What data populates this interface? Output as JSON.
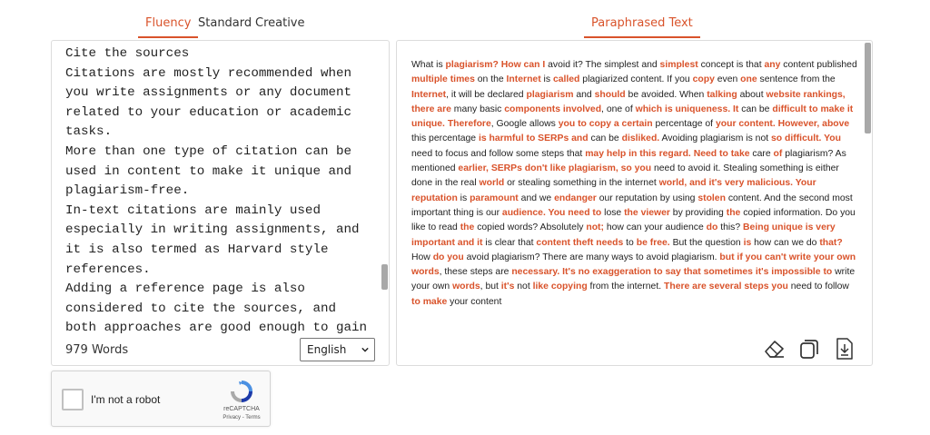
{
  "modes": {
    "fluency": "Fluency",
    "standard": "Standard",
    "creative": "Creative"
  },
  "output_tab": "Paraphrased Text",
  "input": {
    "text": "Cite the sources\nCitations are mostly recommended when you write assignments or any document related to your education or academic tasks.\nMore than one type of citation can be used in content to make it unique and plagiarism-free.\nIn-text citations are mainly used especially in writing assignments, and it is also termed as Harvard style references.\nAdding a reference page is also considered to cite the sources, and both approaches are good enough to gain trust and free yourself from plagiarism.",
    "word_count": "979 Words",
    "language": "English"
  },
  "output": {
    "segments": [
      {
        "t": "What is "
      },
      {
        "t": "plagiarism? How can I",
        "h": true
      },
      {
        "t": " avoid it? The simplest and "
      },
      {
        "t": "simplest",
        "h": true
      },
      {
        "t": " concept is that "
      },
      {
        "t": "any",
        "h": true
      },
      {
        "t": " content published "
      },
      {
        "t": "multiple times",
        "h": true
      },
      {
        "t": " on the "
      },
      {
        "t": "Internet",
        "h": true
      },
      {
        "t": " is "
      },
      {
        "t": "called",
        "h": true
      },
      {
        "t": " plagiarized content. If you "
      },
      {
        "t": "copy",
        "h": true
      },
      {
        "t": " even "
      },
      {
        "t": "one",
        "h": true
      },
      {
        "t": " sentence from the "
      },
      {
        "t": "Internet",
        "h": true
      },
      {
        "t": ", it will be declared "
      },
      {
        "t": "plagiarism",
        "h": true
      },
      {
        "t": " and "
      },
      {
        "t": "should",
        "h": true
      },
      {
        "t": " be avoided. When "
      },
      {
        "t": "talking",
        "h": true
      },
      {
        "t": " about "
      },
      {
        "t": "website rankings, there are",
        "h": true
      },
      {
        "t": " many basic "
      },
      {
        "t": "components involved",
        "h": true
      },
      {
        "t": ", one of "
      },
      {
        "t": "which is uniqueness. It",
        "h": true
      },
      {
        "t": " can be "
      },
      {
        "t": "difficult to make it unique. Therefore",
        "h": true
      },
      {
        "t": ", Google allows "
      },
      {
        "t": "you to copy a certain",
        "h": true
      },
      {
        "t": " percentage of "
      },
      {
        "t": "your content. However, above",
        "h": true
      },
      {
        "t": " this percentage "
      },
      {
        "t": "is harmful to SERPs and",
        "h": true
      },
      {
        "t": " can be "
      },
      {
        "t": "disliked.",
        "h": true
      },
      {
        "t": " Avoiding plagiarism is not "
      },
      {
        "t": "so difficult. You",
        "h": true
      },
      {
        "t": " need to focus and follow some steps that "
      },
      {
        "t": "may help in this regard. Need to take",
        "h": true
      },
      {
        "t": " care "
      },
      {
        "t": "of",
        "h": true
      },
      {
        "t": " plagiarism? As  mentioned "
      },
      {
        "t": "earlier, SERPs don't like plagiarism, so you",
        "h": true
      },
      {
        "t": " need to avoid it. Stealing something is  either  done in the real "
      },
      {
        "t": "world",
        "h": true
      },
      {
        "t": " or  stealing something in the internet "
      },
      {
        "t": "world, and it's very malicious. Your reputation",
        "h": true
      },
      {
        "t": " is "
      },
      {
        "t": "paramount",
        "h": true
      },
      {
        "t": " and we "
      },
      {
        "t": "endanger",
        "h": true
      },
      {
        "t": " our reputation  by using "
      },
      {
        "t": "stolen",
        "h": true
      },
      {
        "t": " content. And the second most important thing is our "
      },
      {
        "t": "audience. You need to",
        "h": true
      },
      {
        "t": " lose "
      },
      {
        "t": "the viewer",
        "h": true
      },
      {
        "t": " by providing "
      },
      {
        "t": "the",
        "h": true
      },
      {
        "t": " copied information. Do you like to read "
      },
      {
        "t": "the",
        "h": true
      },
      {
        "t": " copied words? Absolutely "
      },
      {
        "t": "not;",
        "h": true
      },
      {
        "t": " how can your audience "
      },
      {
        "t": "do",
        "h": true
      },
      {
        "t": " this? "
      },
      {
        "t": "Being unique is very important and it",
        "h": true
      },
      {
        "t": " is clear that "
      },
      {
        "t": "content theft needs",
        "h": true
      },
      {
        "t": " to "
      },
      {
        "t": "be free.",
        "h": true
      },
      {
        "t": " But the question "
      },
      {
        "t": "is",
        "h": true
      },
      {
        "t": " how can we do "
      },
      {
        "t": "that?",
        "h": true
      },
      {
        "t": " How "
      },
      {
        "t": "do you",
        "h": true
      },
      {
        "t": " avoid plagiarism? There are many ways to avoid plagiarism. "
      },
      {
        "t": "but if you can't write your own words",
        "h": true
      },
      {
        "t": ", these steps are "
      },
      {
        "t": "necessary. It's no exaggeration to say that sometimes it's impossible to",
        "h": true
      },
      {
        "t": " write your own "
      },
      {
        "t": "words",
        "h": true
      },
      {
        "t": ", but "
      },
      {
        "t": "it's",
        "h": true
      },
      {
        "t": " not "
      },
      {
        "t": "like copying",
        "h": true
      },
      {
        "t": " from the internet. "
      },
      {
        "t": "There are several steps you",
        "h": true
      },
      {
        "t": " need to follow "
      },
      {
        "t": "to make",
        "h": true
      },
      {
        "t": " your content"
      }
    ],
    "icons": [
      "eraser-icon",
      "copy-icon",
      "download-icon"
    ]
  },
  "recaptcha": {
    "label": "I'm not a robot",
    "brand": "reCAPTCHA",
    "terms": "Privacy - Terms"
  },
  "colors": {
    "accent": "#d9532b",
    "border": "#dcdcdc",
    "scrollbar": "#a8a8a8"
  }
}
